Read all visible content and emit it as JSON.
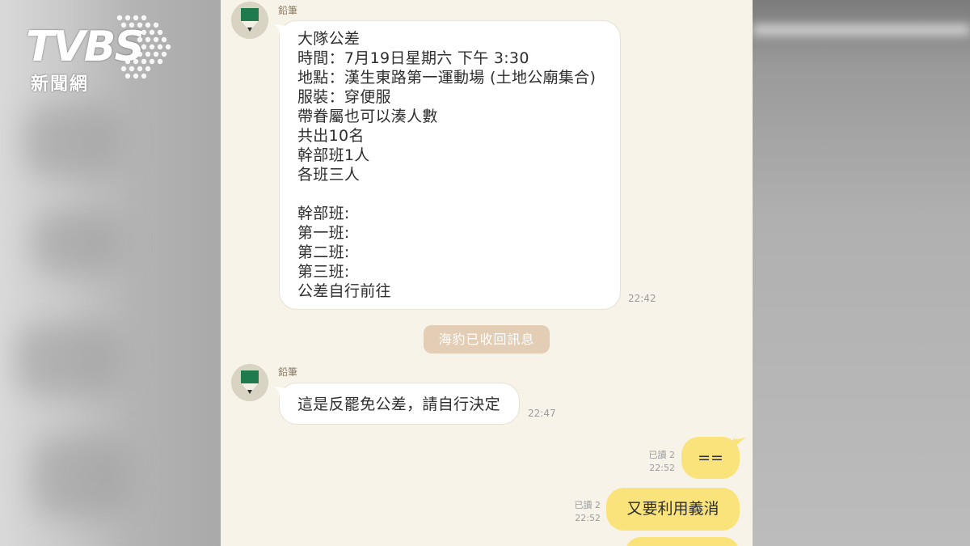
{
  "logo": {
    "brand": "TVBS",
    "subtitle": "新聞網"
  },
  "messages": {
    "first": {
      "sender": "鉛筆",
      "lines": [
        "大隊公差",
        "時間：7月19日星期六 下午 3:30",
        "地點：漢生東路第一運動場 (土地公廟集合)",
        "服裝：穿便服",
        "帶眷屬也可以湊人數",
        "共出10名",
        "幹部班1人",
        "各班三人",
        "",
        "幹部班:",
        "第一班:",
        "第二班:",
        "第三班:",
        "公差自行前往"
      ],
      "time": "22:42"
    },
    "system_notice": "海豹已收回訊息",
    "second": {
      "sender": "鉛筆",
      "text": "這是反罷免公差，請自行決定",
      "time": "22:47"
    },
    "reply1": {
      "read": "已讀 2",
      "time": "22:52",
      "text": "=="
    },
    "reply2": {
      "read": "已讀 2",
      "time": "22:52",
      "text": "又要利用義消"
    }
  },
  "colors": {
    "chat_background": "#f7f3e8",
    "incoming_bubble": "#ffffff",
    "outgoing_bubble": "#f9e37a",
    "system_pill": "#e3cdb5",
    "avatar_green": "#1f7a4d"
  },
  "icons": {
    "avatar": "pencil-avatar-icon"
  }
}
